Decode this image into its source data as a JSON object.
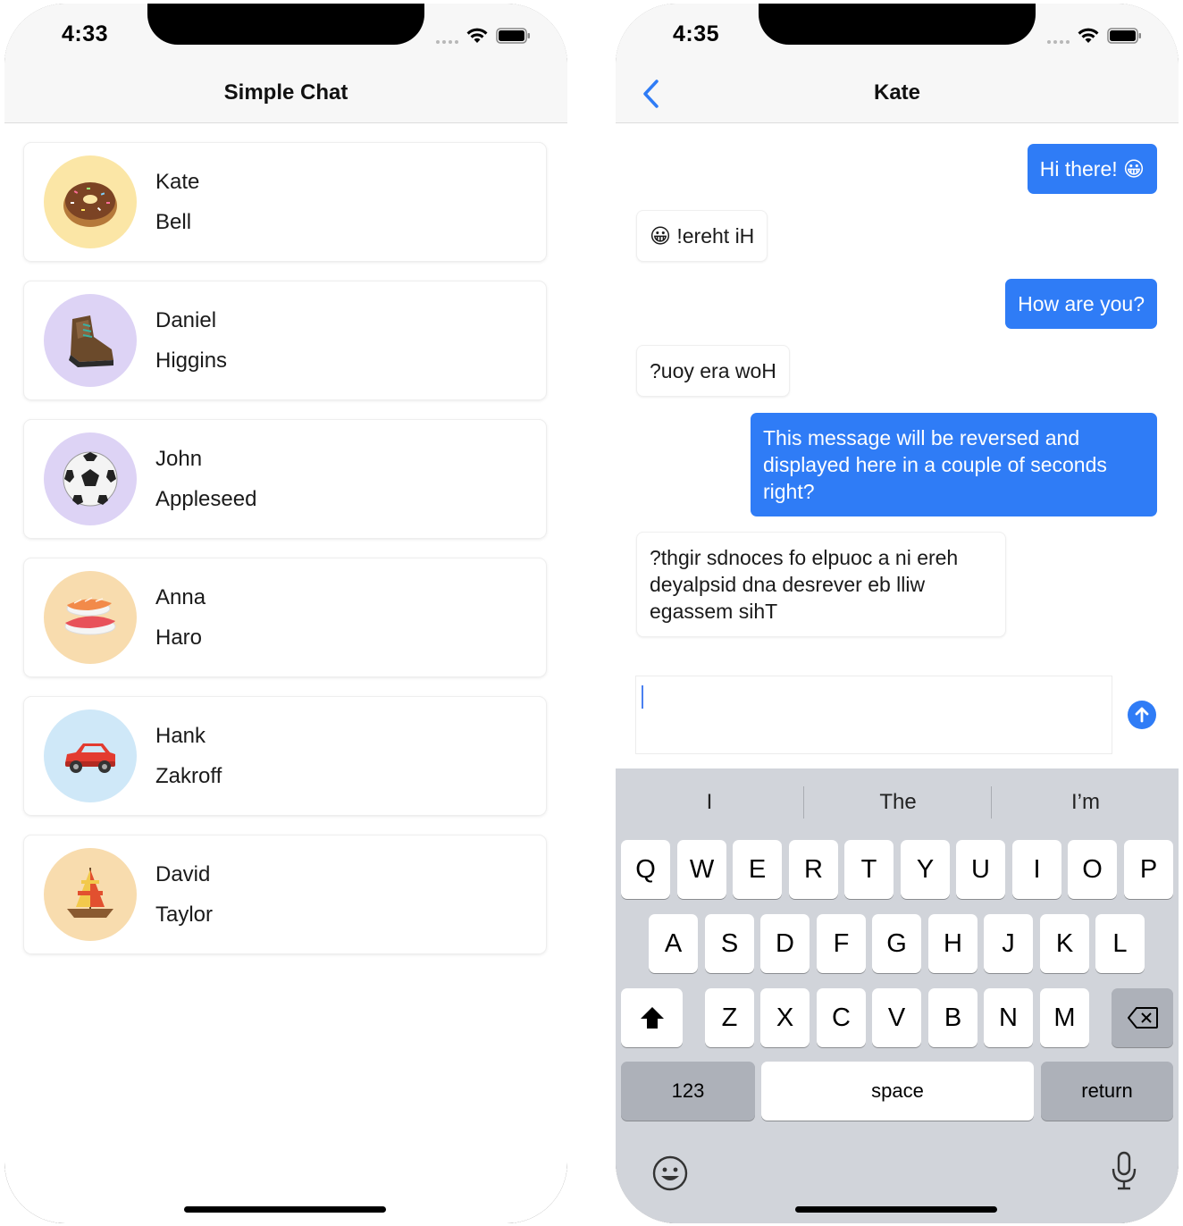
{
  "left_screen": {
    "status_time": "4:33",
    "title": "Simple Chat",
    "contacts": [
      {
        "first": "Kate",
        "last": "Bell",
        "avatar_icon": "donut-icon",
        "avatar_bg": "#fbe6a6"
      },
      {
        "first": "Daniel",
        "last": "Higgins",
        "avatar_icon": "hiking-boot-icon",
        "avatar_bg": "#ddd3f5"
      },
      {
        "first": "John",
        "last": "Appleseed",
        "avatar_icon": "soccer-ball-icon",
        "avatar_bg": "#ddd3f5"
      },
      {
        "first": "Anna",
        "last": "Haro",
        "avatar_icon": "sushi-icon",
        "avatar_bg": "#f8dcae"
      },
      {
        "first": "Hank",
        "last": "Zakroff",
        "avatar_icon": "car-icon",
        "avatar_bg": "#cfe8f8"
      },
      {
        "first": "David",
        "last": "Taylor",
        "avatar_icon": "sailboat-icon",
        "avatar_bg": "#f8dcae"
      }
    ]
  },
  "right_screen": {
    "status_time": "4:35",
    "title": "Kate",
    "messages": [
      {
        "direction": "out",
        "text": "Hi there! 😀"
      },
      {
        "direction": "in",
        "text": "😀 !ereht iH"
      },
      {
        "direction": "out",
        "text": "How are you?"
      },
      {
        "direction": "in",
        "text": "?uoy era woH"
      },
      {
        "direction": "out",
        "text": "This message will be reversed and displayed here in a couple of seconds right?"
      },
      {
        "direction": "in",
        "text": "?thgir sdnoces fo elpuoc a ni ereh deyalpsid dna desrever eb lliw egassem sihT"
      }
    ],
    "input_value": "",
    "keyboard": {
      "suggestions": [
        "I",
        "The",
        "I’m"
      ],
      "row1": [
        "Q",
        "W",
        "E",
        "R",
        "T",
        "Y",
        "U",
        "I",
        "O",
        "P"
      ],
      "row2": [
        "A",
        "S",
        "D",
        "F",
        "G",
        "H",
        "J",
        "K",
        "L"
      ],
      "row3": [
        "Z",
        "X",
        "C",
        "V",
        "B",
        "N",
        "M"
      ],
      "numbers_label": "123",
      "space_label": "space",
      "return_label": "return"
    }
  },
  "colors": {
    "accent": "#2f7cf6",
    "nav_background": "#f7f7f7",
    "keyboard_background": "#d1d4da"
  }
}
